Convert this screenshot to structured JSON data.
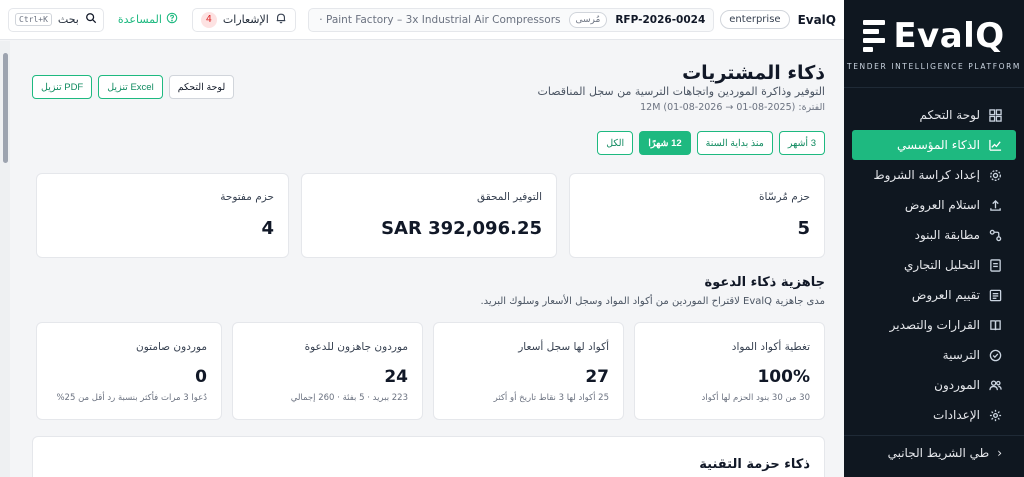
{
  "sidebar": {
    "logo_text": "EvalQ",
    "logo_tagline": "TENDER INTELLIGENCE PLATFORM",
    "items": [
      {
        "label": "لوحة التحكم",
        "icon": "grid-icon"
      },
      {
        "label": "الذكاء المؤسسي",
        "icon": "chart-line-icon",
        "active": true
      },
      {
        "label": "إعداد كراسة الشروط",
        "icon": "gear-icon"
      },
      {
        "label": "استلام العروض",
        "icon": "upload-icon"
      },
      {
        "label": "مطابقة البنود",
        "icon": "match-icon"
      },
      {
        "label": "التحليل التجاري",
        "icon": "document-icon"
      },
      {
        "label": "تقييم العروض",
        "icon": "list-icon"
      },
      {
        "label": "القرارات والتصدير",
        "icon": "book-icon"
      },
      {
        "label": "الترسية",
        "icon": "check-circle-icon"
      },
      {
        "label": "الموردون",
        "icon": "users-icon"
      },
      {
        "label": "الإعدادات",
        "icon": "settings-icon"
      }
    ],
    "collapse_label": "طي الشريط الجانبي"
  },
  "topbar": {
    "brand": "EvalQ",
    "tenant": "enterprise",
    "rfp_code": "RFP-2026-0024",
    "rfp_title": "· Paint Factory – 3x Industrial Air Compressors",
    "rfp_status": "مُرسى",
    "notifications_label": "الإشعارات",
    "notifications_count": "4",
    "help_label": "المساعدة",
    "search_label": "بحث",
    "search_shortcut": "Ctrl+K"
  },
  "page": {
    "title": "ذكاء المشتريات",
    "subtitle": "التوفير وذاكرة الموردين واتجاهات الترسية من سجل المناقصات",
    "period": "الفترة: (2025-08-01 → 2026-08-01) 12M",
    "actions": {
      "pdf": "تنزيل PDF",
      "excel": "تنزيل Excel",
      "dashboard": "لوحة التحكم"
    },
    "periods": [
      "3 أشهر",
      "منذ بداية السنة",
      "12 شهرًا",
      "الكل"
    ]
  },
  "kpis": [
    {
      "label": "حزم مُرسّاة",
      "value": "5"
    },
    {
      "label": "التوفير المحقق",
      "value": "SAR 392,096.25"
    },
    {
      "label": "حزم مفتوحة",
      "value": "4"
    }
  ],
  "readiness": {
    "title": "جاهزية ذكاء الدعوة",
    "subtitle": "مدى جاهزية EvalQ لاقتراح الموردين من أكواد المواد وسجل الأسعار وسلوك البريد.",
    "cards": [
      {
        "label": "تغطية أكواد المواد",
        "value": "100%",
        "note": "30 من 30 بنود الحزم لها أكواد"
      },
      {
        "label": "أكواد لها سجل أسعار",
        "value": "27",
        "note": "25 أكواد لها 3 نقاط تاريخ أو أكثر"
      },
      {
        "label": "موردون جاهزون للدعوة",
        "value": "24",
        "note": "223 ببريد · 5 بفئة · 260 إجمالي"
      },
      {
        "label": "موردون صامتون",
        "value": "0",
        "note": "دُعوا 3 مرات فأكثر بنسبة رد أقل من 25%"
      }
    ]
  },
  "bottom_section": {
    "title": "ذكاء حزمة التقنية"
  }
}
